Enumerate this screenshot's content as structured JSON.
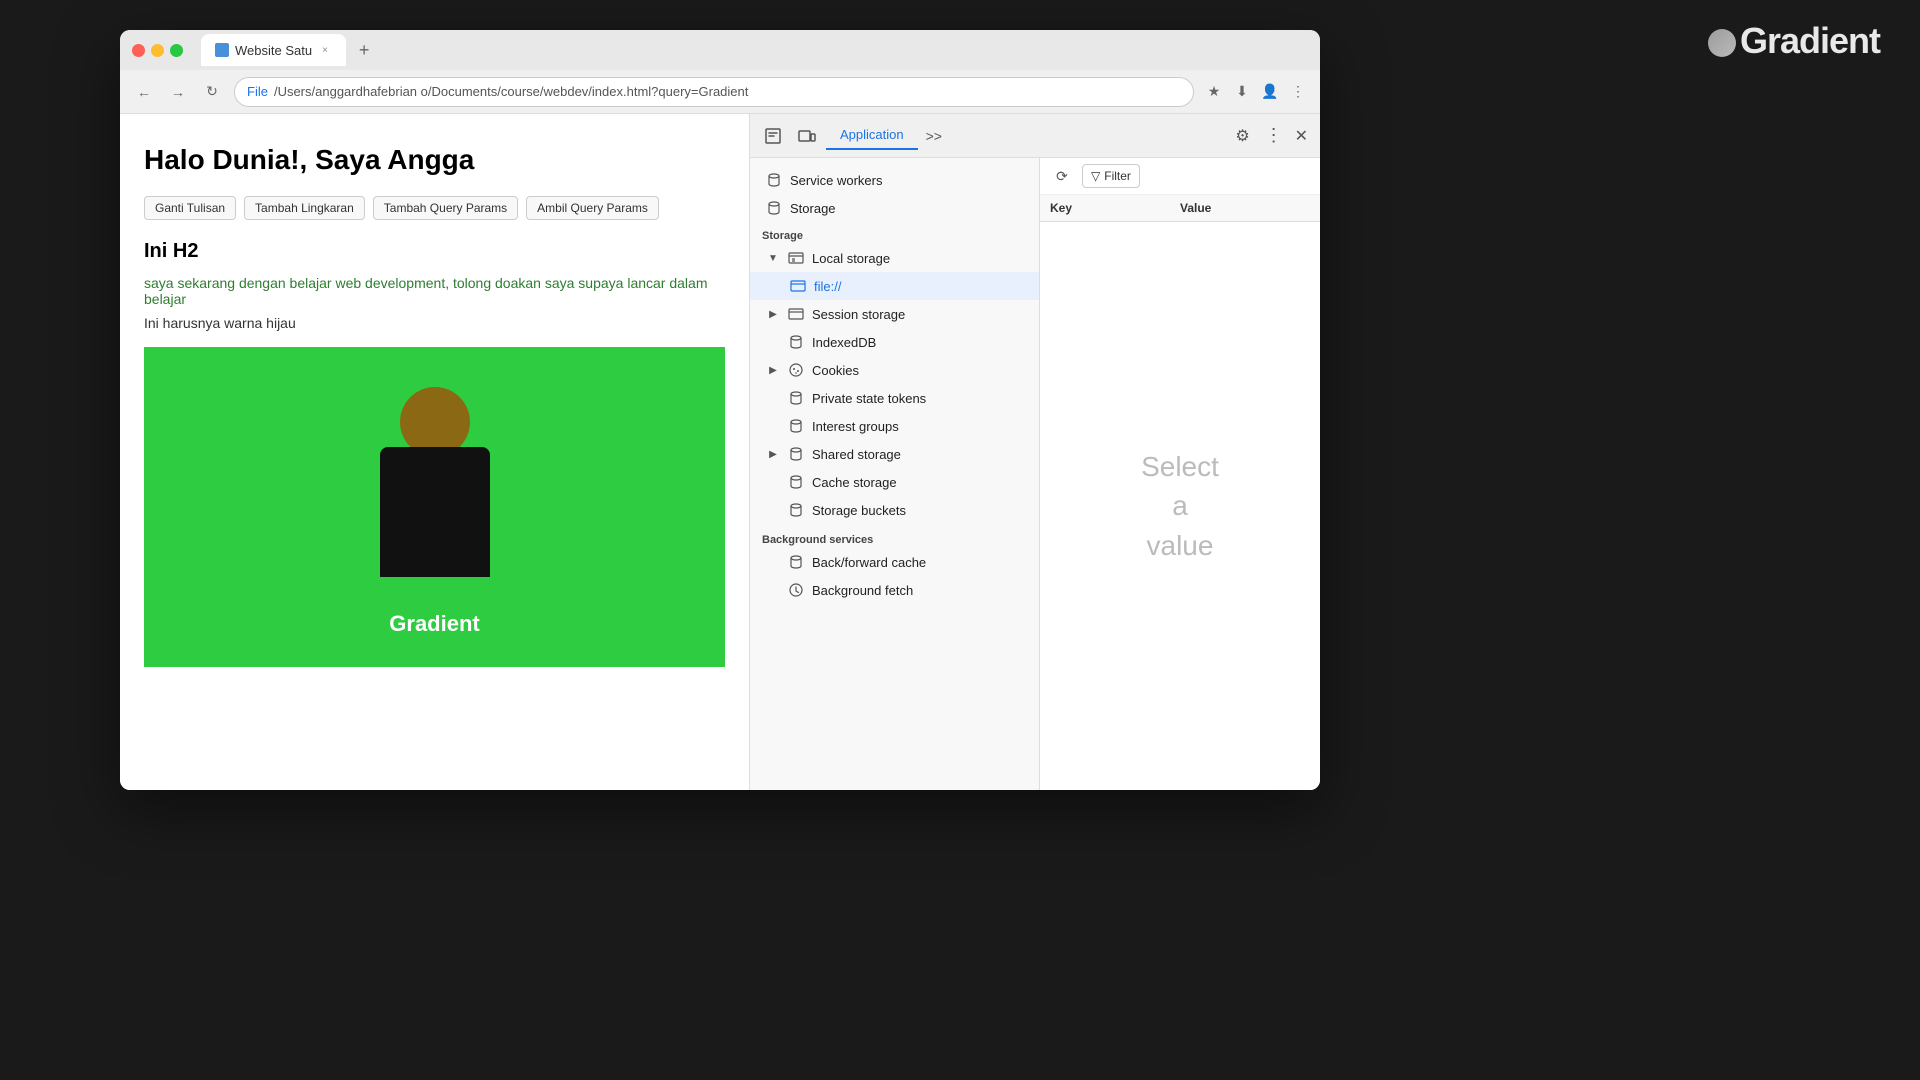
{
  "browser": {
    "tab_title": "Website Satu",
    "tab_close": "×",
    "tab_new": "+",
    "nav": {
      "back": "←",
      "forward": "→",
      "reload": "↻"
    },
    "url": {
      "protocol_label": "File",
      "path": "/Users/anggardhafebrian o/Documents/course/webdev/index.html?query=Gradient"
    },
    "addr_icons": [
      "★",
      "⬇",
      "👤",
      "⋮"
    ]
  },
  "webpage": {
    "title": "Halo Dunia!, Saya Angga",
    "buttons": [
      "Ganti Tulisan",
      "Tambah Lingkaran",
      "Tambah Query Params",
      "Ambil Query Params"
    ],
    "h2": "Ini H2",
    "green_text": "saya sekarang dengan belajar web development, tolong doakan saya supaya lancar dalam belajar",
    "black_text": "Ini harusnya warna hijau",
    "gradient_text": "Gradient"
  },
  "devtools": {
    "tabs": [
      "Application"
    ],
    "active_tab": "Application",
    "toolbar": {
      "refresh_label": "⟳",
      "filter_label": "Filter",
      "more_label": "⋮",
      "close_label": "×"
    },
    "table": {
      "col_key": "Key",
      "col_value": "Value"
    },
    "empty_state": "Select\na\nvalue",
    "sidebar": {
      "top_items": [
        {
          "id": "service-workers",
          "label": "Service workers",
          "icon": "sw"
        },
        {
          "id": "storage",
          "label": "Storage",
          "icon": "db"
        }
      ],
      "storage_section": "Storage",
      "storage_items": [
        {
          "id": "local-storage",
          "label": "Local storage",
          "icon": "table",
          "expandable": true,
          "expanded": true
        },
        {
          "id": "local-storage-file",
          "label": "file://",
          "icon": "table",
          "indent": 2
        },
        {
          "id": "session-storage",
          "label": "Session storage",
          "icon": "table",
          "expandable": true,
          "expanded": false
        },
        {
          "id": "indexeddb",
          "label": "IndexedDB",
          "icon": "db",
          "expandable": false
        },
        {
          "id": "cookies",
          "label": "Cookies",
          "icon": "cookie",
          "expandable": true,
          "expanded": false
        },
        {
          "id": "private-state-tokens",
          "label": "Private state tokens",
          "icon": "db"
        },
        {
          "id": "interest-groups",
          "label": "Interest groups",
          "icon": "db"
        },
        {
          "id": "shared-storage",
          "label": "Shared storage",
          "icon": "db",
          "expandable": true,
          "expanded": false
        },
        {
          "id": "cache-storage",
          "label": "Cache storage",
          "icon": "db"
        },
        {
          "id": "storage-buckets",
          "label": "Storage buckets",
          "icon": "db"
        }
      ],
      "bg_services_section": "Background services",
      "bg_services_items": [
        {
          "id": "back-forward-cache",
          "label": "Back/forward cache",
          "icon": "db"
        },
        {
          "id": "background-fetch",
          "label": "Background fetch",
          "icon": "arrow"
        }
      ]
    }
  }
}
